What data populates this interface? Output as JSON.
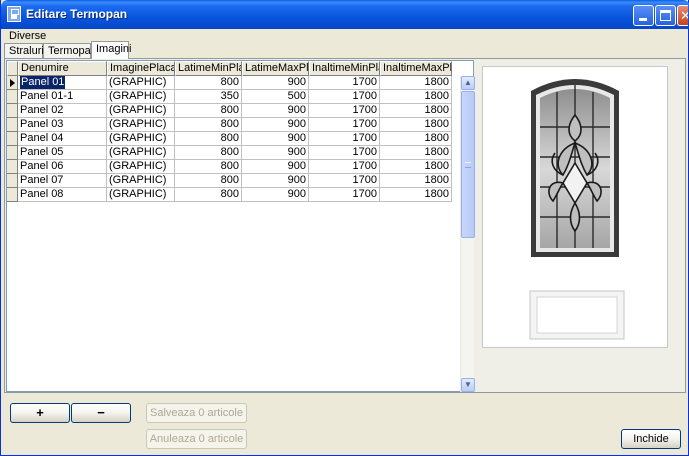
{
  "window": {
    "title": "Editare Termopan",
    "icon": "window-app-icon",
    "controls": {
      "minimize": "minimize-icon",
      "maximize": "maximize-icon",
      "close": "close-icon"
    }
  },
  "menu": {
    "items": [
      "Diverse"
    ]
  },
  "tabs": [
    {
      "label": "Straluri",
      "active": false
    },
    {
      "label": "Termopan",
      "active": false
    },
    {
      "label": "Imagini",
      "active": true
    }
  ],
  "grid": {
    "columns": [
      "Denumire",
      "ImaginePlaca",
      "LatimeMinPlaca",
      "LatimeMaxPlaca",
      "InaltimeMinPlaca",
      "InaltimeMaxPlaca"
    ],
    "rows": [
      [
        "Panel 01",
        "(GRAPHIC)",
        "800",
        "900",
        "1700",
        "1800"
      ],
      [
        "Panel 01-1",
        "(GRAPHIC)",
        "350",
        "500",
        "1700",
        "1800"
      ],
      [
        "Panel 02",
        "(GRAPHIC)",
        "800",
        "900",
        "1700",
        "1800"
      ],
      [
        "Panel 03",
        "(GRAPHIC)",
        "800",
        "900",
        "1700",
        "1800"
      ],
      [
        "Panel 04",
        "(GRAPHIC)",
        "800",
        "900",
        "1700",
        "1800"
      ],
      [
        "Panel 05",
        "(GRAPHIC)",
        "800",
        "900",
        "1700",
        "1800"
      ],
      [
        "Panel 06",
        "(GRAPHIC)",
        "800",
        "900",
        "1700",
        "1800"
      ],
      [
        "Panel 07",
        "(GRAPHIC)",
        "800",
        "900",
        "1700",
        "1800"
      ],
      [
        "Panel 08",
        "(GRAPHIC)",
        "800",
        "900",
        "1700",
        "1800"
      ]
    ],
    "selected_row": 0
  },
  "buttons": {
    "add": "+",
    "remove": "−",
    "save": "Salveaza 0 articole",
    "cancel": "Anuleaza 0 articole",
    "close": "Inchide"
  },
  "colors": {
    "title_bar": "#0855DD",
    "selection": "#0A246A",
    "glass_frame": "#3A3A3A"
  }
}
